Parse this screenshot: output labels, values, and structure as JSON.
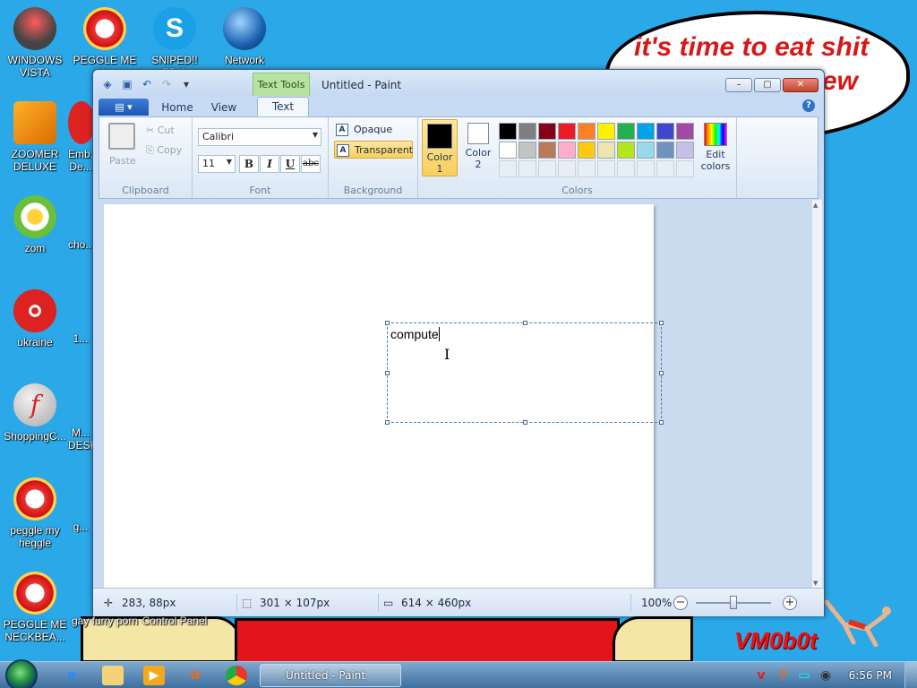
{
  "desktop": {
    "wallpaper_text_line1": "it's time to eat shit",
    "wallpaper_text_line2": "ew",
    "wallpaper_logo": "VM0b0t",
    "icons": [
      {
        "label": "WINDOWS VISTA",
        "icon": "vista-icon"
      },
      {
        "label": "PEGGLE ME M...",
        "icon": "peggle-icon"
      },
      {
        "label": "SNIPED!! EPIC",
        "icon": "skype-icon"
      },
      {
        "label": "Network",
        "icon": "network-icon"
      },
      {
        "label": "ZOOMER DELUXE",
        "icon": "zuma-icon"
      },
      {
        "label": "Emb... De...",
        "icon": "app-icon"
      },
      {
        "label": "zom",
        "icon": "flower-icon"
      },
      {
        "label": "cho...",
        "icon": "app-icon"
      },
      {
        "label": "ukraine",
        "icon": "radiation-icon"
      },
      {
        "label": "1...",
        "icon": "app-icon"
      },
      {
        "label": "ShoppingC...",
        "icon": "flash-icon"
      },
      {
        "label": "M... DESK...",
        "icon": "app-icon"
      },
      {
        "label": "peggle my heggle",
        "icon": "peggle-icon"
      },
      {
        "label": "g...",
        "icon": "app-icon"
      },
      {
        "label": "PEGGLE ME NECKBEA...",
        "icon": "peggle-icon"
      },
      {
        "label": "gay furry porn",
        "icon": "file-icon"
      },
      {
        "label": "Control Panel",
        "icon": "control-panel-icon"
      }
    ]
  },
  "window": {
    "title": "Untitled - Paint",
    "context_tab": "Text Tools",
    "minimize": "–",
    "maximize": "▢",
    "close": "✕"
  },
  "tabs": {
    "home": "Home",
    "view": "View",
    "text": "Text"
  },
  "ribbon": {
    "clipboard": {
      "paste": "Paste",
      "cut": "Cut",
      "copy": "Copy",
      "label": "Clipboard"
    },
    "font": {
      "family": "Calibri",
      "size": "11",
      "bold": "B",
      "italic": "I",
      "underline": "U",
      "strike": "abc",
      "label": "Font"
    },
    "background": {
      "opaque": "Opaque",
      "transparent": "Transparent",
      "label": "Background"
    },
    "colors": {
      "color1_line1": "Color",
      "color1_line2": "1",
      "color2_line1": "Color",
      "color2_line2": "2",
      "edit_line1": "Edit",
      "edit_line2": "colors",
      "label": "Colors",
      "color1_value": "#000000",
      "color2_value": "#ffffff",
      "palette": [
        "#000000",
        "#7f7f7f",
        "#880015",
        "#ed1c24",
        "#ff7f27",
        "#fff200",
        "#22b14c",
        "#00a2e8",
        "#3f48cc",
        "#a349a4",
        "#ffffff",
        "#c3c3c3",
        "#b97a57",
        "#ffaec9",
        "#ffc90e",
        "#efe4b0",
        "#b5e61d",
        "#99d9ea",
        "#7092be",
        "#c8bfe7"
      ]
    }
  },
  "canvas": {
    "typed_text": "compute"
  },
  "status": {
    "cursor_pos": "283, 88px",
    "selection_size": "301 × 107px",
    "image_size": "614 × 460px",
    "zoom": "100%"
  },
  "taskbar": {
    "active_task": "Untitled - Paint",
    "clock": "6:56 PM"
  }
}
